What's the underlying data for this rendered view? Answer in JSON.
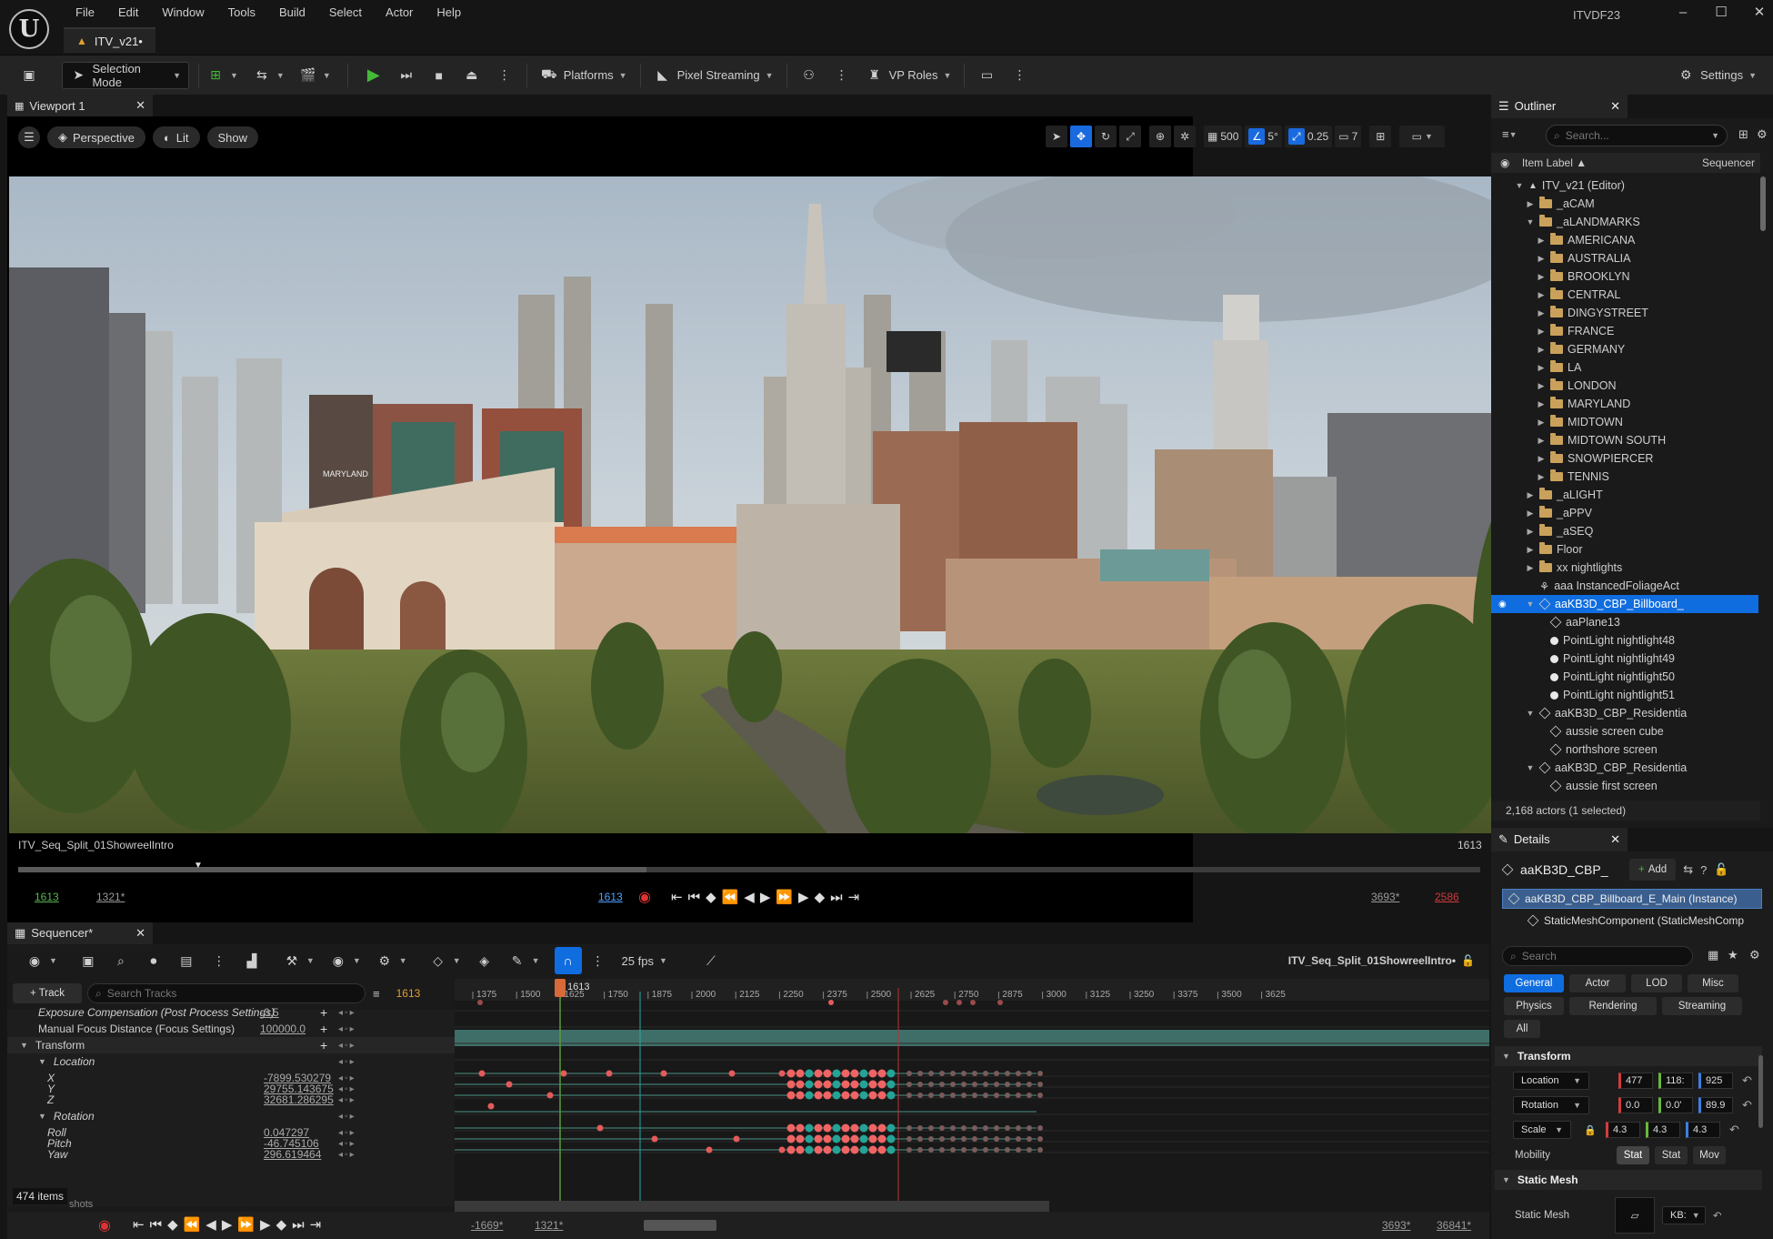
{
  "app": {
    "logo": "U",
    "project": "ITVDF23"
  },
  "menu": [
    "File",
    "Edit",
    "Window",
    "Tools",
    "Build",
    "Select",
    "Actor",
    "Help"
  ],
  "window_controls": {
    "minimize": "–",
    "maximize": "☐",
    "close": "✕"
  },
  "doc_tab": {
    "label": "ITV_v21•"
  },
  "toolbar": {
    "mode": "Selection Mode",
    "platforms": "Platforms",
    "pixel_streaming": "Pixel Streaming",
    "vp_roles": "VP Roles",
    "settings": "Settings"
  },
  "viewport": {
    "tab": "Viewport 1",
    "perspective": "Perspective",
    "lit": "Lit",
    "show": "Show",
    "grid_size": "500",
    "angle_snap": "5°",
    "scale_snap": "0.25",
    "camera_speed": "7",
    "billboard_name": "MARYLAND"
  },
  "playback": {
    "sequence": "ITV_Seq_Split_01ShowreelIntro",
    "frame_right": "1613",
    "start_green": "1613",
    "start": "1321*",
    "current": "1613",
    "end": "3693*",
    "end_red": "2586",
    "progress": 0.43
  },
  "outliner": {
    "tab": "Outliner",
    "search_placeholder": "Search...",
    "col_label": "Item Label ▲",
    "col_seq": "Sequencer",
    "items": [
      {
        "label": "ITV_v21 (Editor)",
        "depth": 1,
        "icon": "level",
        "tri": "▼"
      },
      {
        "label": "_aCAM",
        "depth": 2,
        "icon": "folder",
        "tri": "▶"
      },
      {
        "label": "_aLANDMARKS",
        "depth": 2,
        "icon": "folder",
        "tri": "▼"
      },
      {
        "label": "AMERICANA",
        "depth": 3,
        "icon": "folder",
        "tri": "▶"
      },
      {
        "label": "AUSTRALIA",
        "depth": 3,
        "icon": "folder",
        "tri": "▶"
      },
      {
        "label": "BROOKLYN",
        "depth": 3,
        "icon": "folder",
        "tri": "▶"
      },
      {
        "label": "CENTRAL",
        "depth": 3,
        "icon": "folder",
        "tri": "▶"
      },
      {
        "label": "DINGYSTREET",
        "depth": 3,
        "icon": "folder",
        "tri": "▶"
      },
      {
        "label": "FRANCE",
        "depth": 3,
        "icon": "folder",
        "tri": "▶"
      },
      {
        "label": "GERMANY",
        "depth": 3,
        "icon": "folder",
        "tri": "▶"
      },
      {
        "label": "LA",
        "depth": 3,
        "icon": "folder",
        "tri": "▶"
      },
      {
        "label": "LONDON",
        "depth": 3,
        "icon": "folder",
        "tri": "▶"
      },
      {
        "label": "MARYLAND",
        "depth": 3,
        "icon": "folder",
        "tri": "▶"
      },
      {
        "label": "MIDTOWN",
        "depth": 3,
        "icon": "folder",
        "tri": "▶"
      },
      {
        "label": "MIDTOWN SOUTH",
        "depth": 3,
        "icon": "folder",
        "tri": "▶"
      },
      {
        "label": "SNOWPIERCER",
        "depth": 3,
        "icon": "folder",
        "tri": "▶"
      },
      {
        "label": "TENNIS",
        "depth": 3,
        "icon": "folder",
        "tri": "▶"
      },
      {
        "label": "_aLIGHT",
        "depth": 2,
        "icon": "folder",
        "tri": "▶"
      },
      {
        "label": "_aPPV",
        "depth": 2,
        "icon": "folder",
        "tri": "▶"
      },
      {
        "label": "_aSEQ",
        "depth": 2,
        "icon": "folder",
        "tri": "▶"
      },
      {
        "label": "Floor",
        "depth": 2,
        "icon": "folder",
        "tri": "▶"
      },
      {
        "label": "xx nightlights",
        "depth": 2,
        "icon": "folder",
        "tri": "▶"
      },
      {
        "label": "aaa InstancedFoliageAct",
        "depth": 2,
        "icon": "foliage",
        "tri": ""
      },
      {
        "label": "aaKB3D_CBP_Billboard_",
        "depth": 2,
        "icon": "mesh",
        "tri": "▼",
        "selected": true
      },
      {
        "label": "aaPlane13",
        "depth": 3,
        "icon": "mesh",
        "tri": ""
      },
      {
        "label": "PointLight nightlight48",
        "depth": 3,
        "icon": "light",
        "tri": ""
      },
      {
        "label": "PointLight nightlight49",
        "depth": 3,
        "icon": "light",
        "tri": ""
      },
      {
        "label": "PointLight nightlight50",
        "depth": 3,
        "icon": "light",
        "tri": ""
      },
      {
        "label": "PointLight nightlight51",
        "depth": 3,
        "icon": "light",
        "tri": ""
      },
      {
        "label": "aaKB3D_CBP_Residentia",
        "depth": 2,
        "icon": "mesh",
        "tri": "▼"
      },
      {
        "label": "aussie screen cube",
        "depth": 3,
        "icon": "mesh",
        "tri": ""
      },
      {
        "label": "northshore screen",
        "depth": 3,
        "icon": "mesh",
        "tri": ""
      },
      {
        "label": "aaKB3D_CBP_Residentia",
        "depth": 2,
        "icon": "mesh",
        "tri": "▼"
      },
      {
        "label": "aussie first screen",
        "depth": 3,
        "icon": "mesh",
        "tri": ""
      }
    ],
    "footer": "2,168 actors (1 selected)"
  },
  "details": {
    "tab": "Details",
    "actor": "aaKB3D_CBP_",
    "add": "Add",
    "instance": "aaKB3D_CBP_Billboard_E_Main (Instance)",
    "component": "StaticMeshComponent (StaticMeshComp",
    "search_placeholder": "Search",
    "categories_row1": [
      "General",
      "Actor",
      "LOD",
      "Misc"
    ],
    "categories_row2": [
      "Physics",
      "Rendering",
      "Streaming"
    ],
    "categories_row3": [
      "All"
    ],
    "transform_header": "Transform",
    "location_label": "Location",
    "location": [
      "477",
      "118:",
      "925"
    ],
    "rotation_label": "Rotation",
    "rotation": [
      "0.0",
      "0.0'",
      "89.9"
    ],
    "scale_label": "Scale",
    "scale": [
      "4.3",
      "4.3",
      "4.3"
    ],
    "mobility_label": "Mobility",
    "mobility": [
      "Stat",
      "Stat",
      "Mov"
    ],
    "static_mesh_header": "Static Mesh",
    "static_mesh_label": "Static Mesh",
    "static_mesh_value": "KB:"
  },
  "sequencer": {
    "tab": "Sequencer*",
    "fps": "25 fps",
    "sequence_name": "ITV_Seq_Split_01ShowreelIntro•",
    "add_track": "+ Track",
    "search_placeholder": "Search Tracks",
    "current_frame": "1613",
    "playhead_label": "1613",
    "ruler_labels": [
      "1375",
      "1500",
      "1625",
      "1750",
      "1875",
      "2000",
      "2125",
      "2250",
      "2375",
      "2500",
      "2625",
      "2750",
      "2875",
      "3000",
      "3125",
      "3250",
      "3375",
      "3500",
      "3625"
    ],
    "tracks": [
      {
        "name": "Exposure Compensation (Post Process Settings)",
        "value": "-0.5",
        "indent": 1,
        "italic": true
      },
      {
        "name": "Manual Focus Distance (Focus Settings)",
        "value": "100000.0",
        "indent": 1,
        "italic": false
      },
      {
        "name": "Transform",
        "value": "",
        "indent": 0,
        "tri": "▼"
      },
      {
        "name": "Location",
        "value": "",
        "indent": 1,
        "tri": "▼",
        "italic": true
      },
      {
        "name": "X",
        "value": "-7899.530279",
        "indent": 2,
        "italic": true
      },
      {
        "name": "Y",
        "value": "29755.143675",
        "indent": 2,
        "italic": true
      },
      {
        "name": "Z",
        "value": "32681.286295",
        "indent": 2,
        "italic": true
      },
      {
        "name": "Rotation",
        "value": "",
        "indent": 1,
        "tri": "▼",
        "italic": true
      },
      {
        "name": "Roll",
        "value": "0.047297",
        "indent": 2,
        "italic": true
      },
      {
        "name": "Pitch",
        "value": "-46.745106",
        "indent": 2,
        "italic": true
      },
      {
        "name": "Yaw",
        "value": "296.619464",
        "indent": 2,
        "italic": true
      }
    ],
    "items_count": "474 items",
    "shots_label": "shots",
    "footer": {
      "start": "-1669*",
      "in": "1321*",
      "out": "3693*",
      "end": "36841*"
    }
  }
}
